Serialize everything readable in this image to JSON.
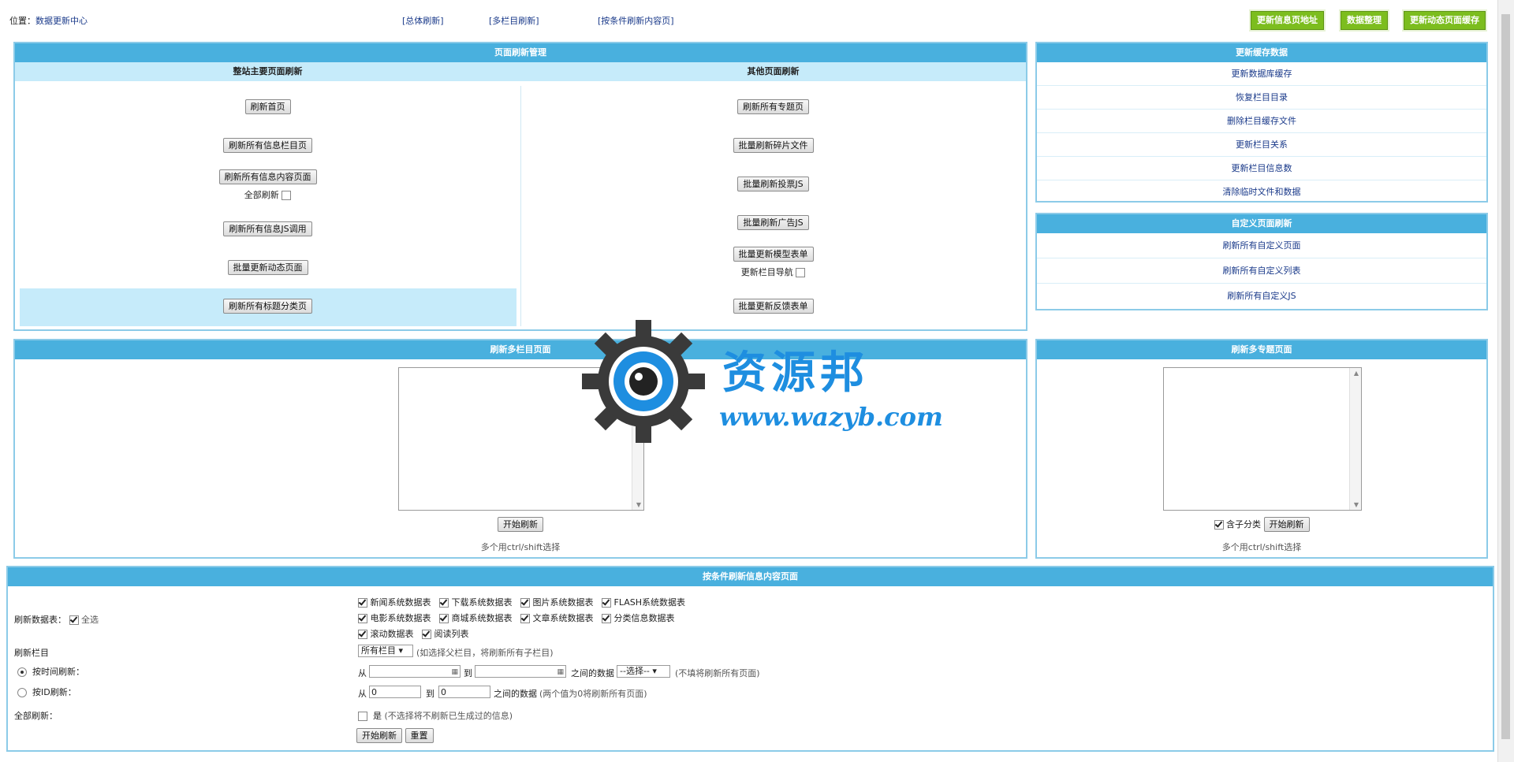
{
  "topbar": {
    "location_label": "位置：",
    "location_link": "数据更新中心",
    "links": [
      "[总体刷新]",
      "[多栏目刷新]",
      "[按条件刷新内容页]"
    ],
    "buttons": [
      "更新信息页地址",
      "数据整理",
      "更新动态页面缓存"
    ]
  },
  "refresh_panel": {
    "title": "页面刷新管理",
    "left_title": "整站主要页面刷新",
    "right_title": "其他页面刷新",
    "left_buttons": [
      "刷新首页",
      "刷新所有信息栏目页",
      "刷新所有信息内容页面",
      "刷新所有信息JS调用",
      "批量更新动态页面",
      "刷新所有标题分类页"
    ],
    "full_refresh_label": "全部刷新",
    "right_buttons": [
      "刷新所有专题页",
      "批量刷新碎片文件",
      "批量刷新投票JS",
      "批量刷新广告JS",
      "批量更新模型表单",
      "批量更新反馈表单"
    ],
    "nav_label": "更新栏目导航"
  },
  "cache_panel": {
    "title": "更新缓存数据",
    "links": [
      "更新数据库缓存",
      "恢复栏目目录",
      "删除栏目缓存文件",
      "更新栏目关系",
      "更新栏目信息数",
      "清除临时文件和数据"
    ]
  },
  "custom_panel": {
    "title": "自定义页面刷新",
    "links": [
      "刷新所有自定义页面",
      "刷新所有自定义列表",
      "刷新所有自定义JS"
    ]
  },
  "multi_column_panel": {
    "title": "刷新多栏目页面",
    "start_button": "开始刷新",
    "hint": "多个用ctrl/shift选择"
  },
  "multi_topic_panel": {
    "title": "刷新多专题页面",
    "include_sub_label": "含子分类",
    "start_button": "开始刷新",
    "hint": "多个用ctrl/shift选择"
  },
  "watermark": {
    "title": "资源邦",
    "url": "www.wazyb.com"
  },
  "condition_panel": {
    "title": "按条件刷新信息内容页面",
    "table_label": "刷新数据表：",
    "select_all_label": "全选",
    "tables": [
      [
        "新闻系统数据表",
        "下载系统数据表",
        "图片系统数据表",
        "FLASH系统数据表"
      ],
      [
        "电影系统数据表",
        "商城系统数据表",
        "文章系统数据表",
        "分类信息数据表"
      ],
      [
        "滚动数据表",
        "阅读列表"
      ]
    ],
    "column_label": "刷新栏目",
    "column_select": "所有栏目",
    "column_hint": "(如选择父栏目，将刷新所有子栏目)",
    "time_label": "按时间刷新：",
    "from_label": "从",
    "to_label": "到",
    "between_label": "之间的数据",
    "time_select": "--选择--",
    "time_hint": "(不填将刷新所有页面)",
    "id_label": "按ID刷新：",
    "id_from": "0",
    "id_to": "0",
    "id_hint": "(两个值为0将刷新所有页面)",
    "all_label": "全部刷新：",
    "yes_label": "是",
    "all_hint": "(不选择将不刷新已生成过的信息)",
    "submit": "开始刷新",
    "reset": "重置"
  }
}
